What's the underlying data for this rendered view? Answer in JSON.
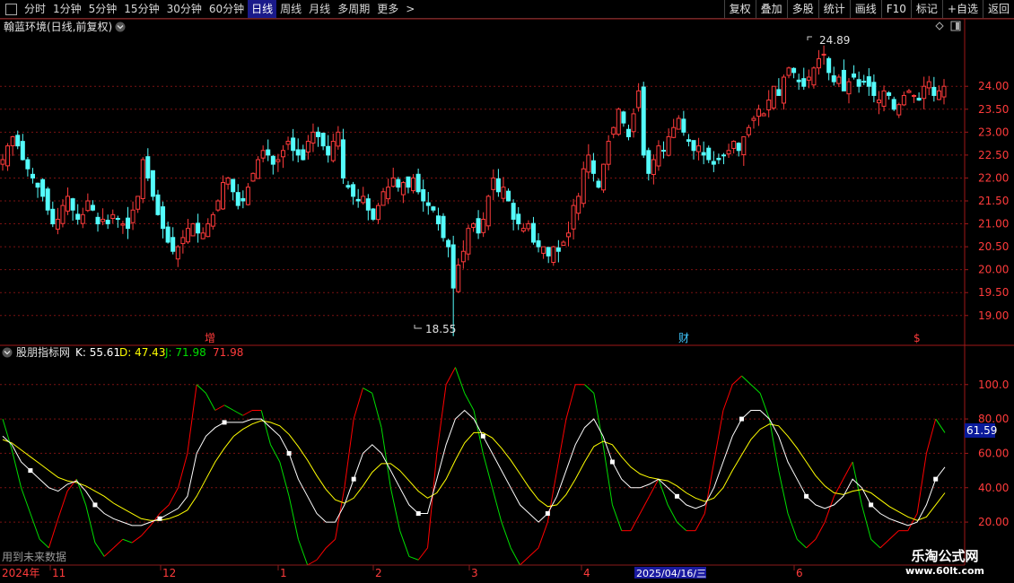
{
  "toolbar": {
    "periods": [
      "分时",
      "1分钟",
      "5分钟",
      "15分钟",
      "30分钟",
      "60分钟",
      "日线",
      "周线",
      "月线",
      "多周期",
      "更多"
    ],
    "active_period": "日线",
    "more_suffix": ">",
    "buttons": [
      "复权",
      "叠加",
      "多股",
      "统计",
      "画线",
      "F10",
      "标记",
      "+自选",
      "返回"
    ]
  },
  "price_panel": {
    "title": "翰蓝环境(日线,前复权)",
    "high_label": "24.89",
    "low_label": "18.55",
    "markers": [
      {
        "text": "增",
        "color": "#ff3b3b"
      },
      {
        "text": "财",
        "color": "#40c8ff"
      },
      {
        "text": "$",
        "color": "#ff3b3b"
      }
    ],
    "axis_ticks": [
      "24.00",
      "23.50",
      "23.00",
      "22.50",
      "22.00",
      "21.50",
      "21.00",
      "20.50",
      "20.00",
      "19.50",
      "19.00"
    ]
  },
  "indicator_panel": {
    "name": "股朋指标网",
    "k_label": "K: 55.61",
    "d_label": "D: 47.43",
    "j_label": "J: 71.98",
    "extra_label": "71.98",
    "current_value": "61.59",
    "axis_ticks": [
      "100.0",
      "80.00",
      "60.00",
      "40.00",
      "20.00"
    ],
    "footer_note": "用到未来数据"
  },
  "time_axis": {
    "year": "2024年",
    "months": [
      "11",
      "12",
      "1",
      "2",
      "3",
      "4",
      "6"
    ],
    "highlight_date": "2025/04/16/三"
  },
  "watermark": {
    "title": "乐淘公式网",
    "url": "www.60lt.com"
  },
  "colors": {
    "up": "#ff3b3b",
    "down": "#54fcfc",
    "k_line": "#ffffff",
    "d_line": "#ffff00",
    "j_up": "#ff0000",
    "j_down": "#00dd00",
    "grid": "#7a1212"
  },
  "chart_data": {
    "type": "candlestick+kdj",
    "price_ylim": [
      18.35,
      25.1
    ],
    "price_high": 24.89,
    "price_low": 18.55,
    "closes": [
      22.4,
      22.7,
      22.9,
      22.7,
      22.4,
      22.2,
      22.0,
      21.8,
      21.6,
      21.3,
      21.0,
      21.1,
      21.4,
      21.6,
      21.3,
      21.1,
      21.2,
      21.5,
      21.3,
      21.0,
      21.1,
      21.0,
      21.2,
      21.1,
      21.0,
      20.9,
      21.3,
      21.6,
      22.4,
      22.0,
      21.6,
      21.2,
      20.9,
      20.6,
      20.4,
      20.5,
      20.7,
      20.9,
      21.0,
      20.8,
      20.8,
      21.0,
      21.2,
      21.5,
      21.9,
      22.0,
      21.7,
      21.4,
      21.5,
      21.8,
      22.1,
      22.4,
      22.6,
      22.5,
      22.3,
      22.4,
      22.6,
      22.8,
      22.6,
      22.5,
      22.4,
      22.8,
      23.0,
      22.9,
      22.7,
      22.5,
      22.8,
      23.0,
      22.0,
      21.8,
      21.6,
      21.5,
      21.6,
      21.3,
      21.1,
      21.4,
      21.7,
      21.8,
      22.0,
      21.8,
      21.9,
      21.8,
      22.0,
      21.7,
      21.5,
      21.4,
      21.3,
      21.0,
      20.7,
      20.5,
      19.6,
      20.1,
      20.4,
      20.9,
      21.0,
      20.8,
      21.1,
      21.6,
      22.0,
      21.7,
      21.8,
      21.5,
      21.1,
      21.0,
      20.9,
      21.0,
      20.6,
      20.5,
      20.5,
      20.3,
      20.5,
      20.4,
      20.6,
      20.8,
      21.4,
      21.6,
      22.2,
      22.5,
      22.1,
      21.8,
      22.3,
      22.8,
      23.1,
      23.5,
      23.2,
      22.9,
      23.4,
      23.9,
      22.5,
      22.1,
      22.4,
      22.7,
      22.6,
      22.9,
      23.1,
      23.3,
      23.0,
      22.8,
      22.6,
      22.7,
      22.5,
      22.4,
      22.3,
      22.4,
      22.5,
      22.6,
      22.8,
      22.6,
      22.9,
      23.1,
      23.3,
      23.5,
      23.4,
      23.7,
      24.0,
      23.8,
      24.2,
      24.4,
      24.3,
      24.1,
      24.0,
      24.2,
      24.4,
      24.6,
      24.7,
      24.3,
      24.1,
      24.2,
      23.9,
      24.1,
      24.2,
      24.0,
      24.1,
      24.0,
      23.8,
      23.7,
      23.9,
      23.8,
      23.5,
      23.6,
      23.8,
      23.9,
      23.8,
      23.7,
      24.0,
      24.1,
      23.8,
      23.9,
      24.0
    ],
    "kdj_ylim": [
      -5,
      115
    ],
    "k": [
      70,
      65,
      55,
      50,
      45,
      40,
      38,
      42,
      44,
      38,
      30,
      25,
      22,
      20,
      18,
      18,
      20,
      22,
      25,
      28,
      35,
      60,
      70,
      75,
      78,
      78,
      78,
      80,
      80,
      75,
      70,
      60,
      45,
      35,
      25,
      20,
      20,
      30,
      45,
      60,
      65,
      60,
      50,
      40,
      30,
      25,
      25,
      45,
      65,
      80,
      85,
      80,
      70,
      60,
      50,
      40,
      30,
      25,
      20,
      25,
      35,
      50,
      65,
      75,
      80,
      70,
      55,
      45,
      40,
      40,
      42,
      45,
      40,
      35,
      30,
      28,
      30,
      40,
      55,
      70,
      80,
      85,
      85,
      80,
      70,
      55,
      45,
      35,
      30,
      28,
      30,
      35,
      45,
      40,
      30,
      25,
      22,
      20,
      18,
      20,
      30,
      45,
      52
    ],
    "d": [
      68,
      66,
      62,
      58,
      54,
      50,
      46,
      44,
      43,
      41,
      38,
      35,
      31,
      28,
      25,
      22,
      21,
      21,
      22,
      24,
      27,
      35,
      45,
      55,
      63,
      70,
      74,
      77,
      79,
      78,
      76,
      71,
      64,
      56,
      47,
      39,
      33,
      31,
      34,
      41,
      49,
      54,
      54,
      50,
      44,
      38,
      34,
      37,
      45,
      56,
      66,
      72,
      72,
      69,
      63,
      56,
      48,
      40,
      33,
      29,
      30,
      36,
      45,
      55,
      64,
      67,
      65,
      58,
      52,
      48,
      46,
      45,
      44,
      41,
      37,
      34,
      32,
      34,
      40,
      50,
      59,
      68,
      74,
      77,
      76,
      70,
      63,
      55,
      47,
      41,
      37,
      36,
      38,
      39,
      37,
      33,
      29,
      26,
      23,
      21,
      23,
      30,
      37
    ],
    "j": [
      80,
      62,
      40,
      25,
      10,
      5,
      22,
      38,
      45,
      30,
      8,
      0,
      5,
      10,
      8,
      12,
      18,
      25,
      30,
      40,
      60,
      100,
      95,
      85,
      88,
      85,
      82,
      85,
      85,
      65,
      55,
      35,
      10,
      -5,
      -2,
      5,
      10,
      40,
      80,
      98,
      95,
      75,
      40,
      15,
      0,
      -2,
      5,
      60,
      100,
      110,
      95,
      85,
      60,
      40,
      20,
      5,
      -5,
      0,
      5,
      20,
      50,
      80,
      100,
      100,
      95,
      65,
      30,
      15,
      15,
      25,
      35,
      45,
      30,
      20,
      15,
      15,
      25,
      55,
      85,
      100,
      105,
      100,
      95,
      80,
      50,
      25,
      10,
      5,
      10,
      20,
      35,
      45,
      55,
      30,
      10,
      5,
      10,
      15,
      15,
      25,
      60,
      80,
      72
    ]
  }
}
